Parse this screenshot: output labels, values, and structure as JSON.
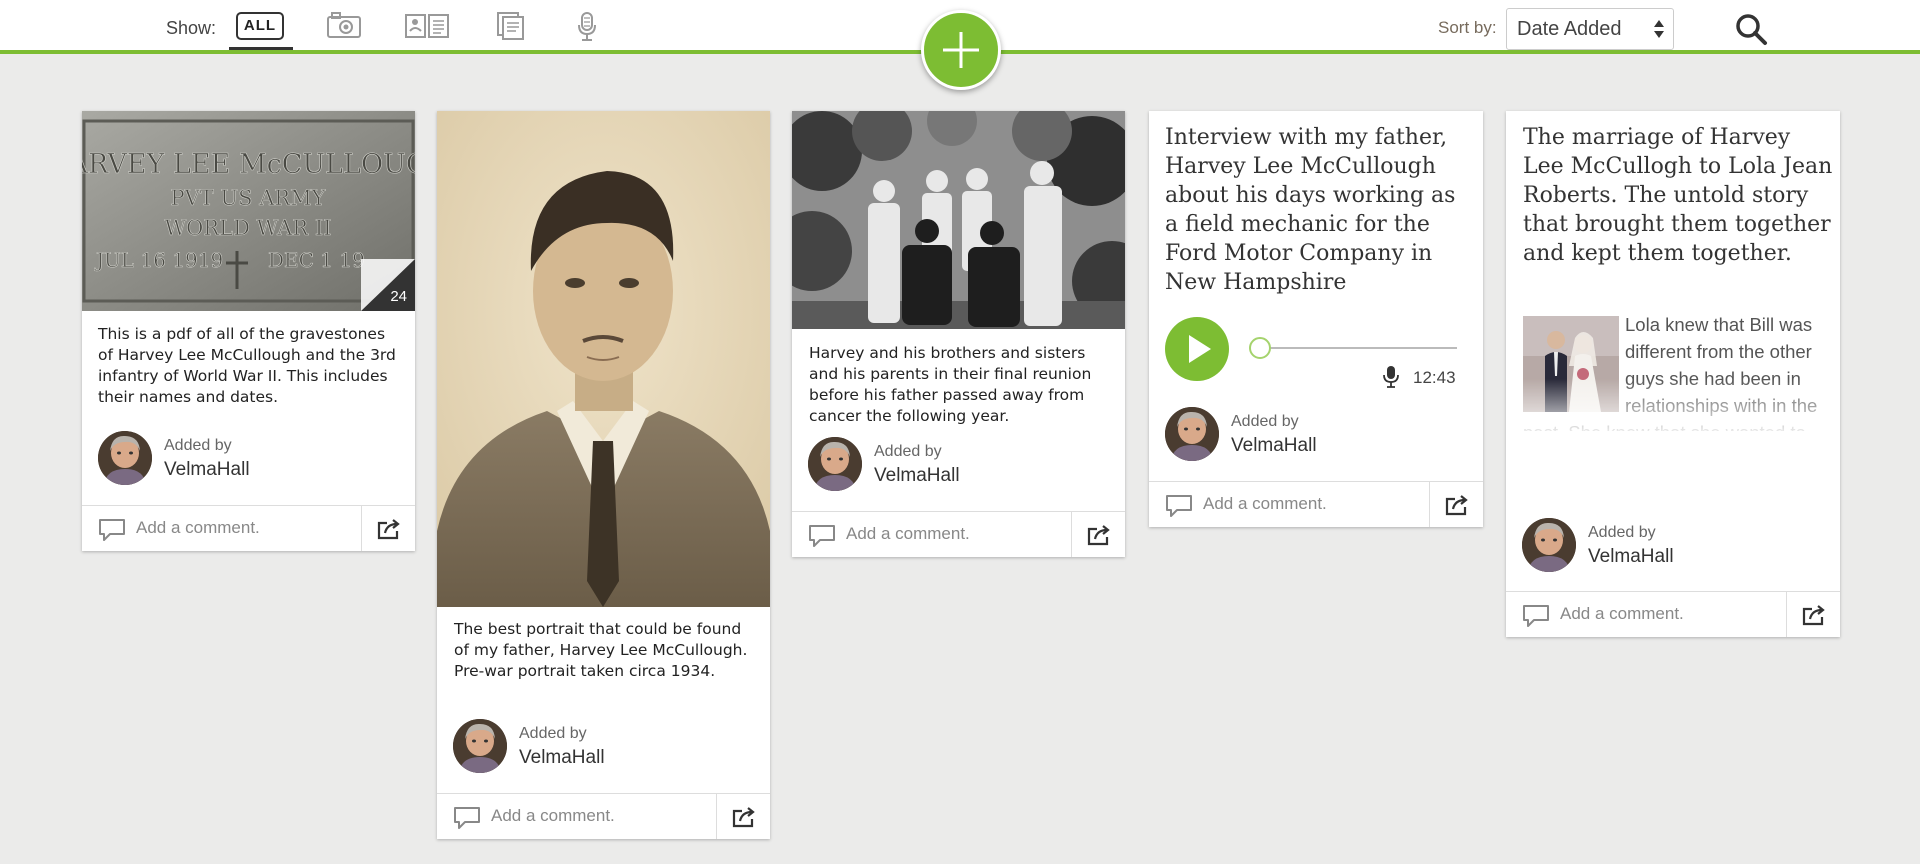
{
  "toolbar": {
    "show_label": "Show:",
    "filter_all": "ALL",
    "filters": [
      "photo-icon",
      "document-icon",
      "story-icon",
      "audio-icon"
    ],
    "sort_label": "Sort by:",
    "sort_value": "Date Added",
    "accent_color": "#7dbd33"
  },
  "cards": [
    {
      "type": "document",
      "image": "gravestone-photo",
      "page_count": "24",
      "caption": "This is a pdf of all of the gravestones of Harvey Lee McCullough and the 3rd infantry of World War II. This includes their names and dates.",
      "added_by": "Added by",
      "username": "VelmaHall",
      "comment_placeholder": "Add a comment."
    },
    {
      "type": "photo",
      "image": "portrait-photo",
      "caption": "The best portrait that could be found of my father, Harvey Lee McCullough. Pre-war portrait taken circa 1934.",
      "added_by": "Added by",
      "username": "VelmaHall",
      "comment_placeholder": "Add a comment."
    },
    {
      "type": "photo",
      "image": "family-reunion-photo",
      "caption": "Harvey and his brothers and sisters and his parents in their final reunion before his father passed away from cancer the following year.",
      "added_by": "Added by",
      "username": "VelmaHall",
      "comment_placeholder": "Add a comment."
    },
    {
      "type": "audio",
      "title": "Interview with my father, Harvey Lee McCullough about his days working as a field mechanic for the Ford Motor Company in New Hampshire",
      "duration": "12:43",
      "progress": 0,
      "added_by": "Added by",
      "username": "VelmaHall",
      "comment_placeholder": "Add a comment."
    },
    {
      "type": "story",
      "title": "The marriage of Harvey Lee McCullogh to Lola Jean Roberts. The untold story that brought them together and kept them together.",
      "image": "wedding-photo",
      "excerpt": "Lola knew that Bill was different from the other guys she had been in relationships with in the past. She knew that she wanted to marry Bill. However, Bill was...",
      "added_by": "Added by",
      "username": "VelmaHall",
      "comment_placeholder": "Add a comment."
    }
  ]
}
